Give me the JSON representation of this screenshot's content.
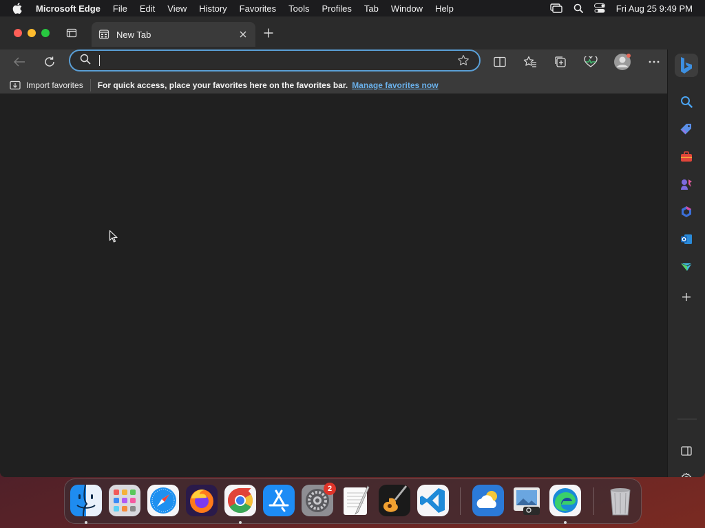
{
  "menubar": {
    "app_name": "Microsoft Edge",
    "menus": [
      "File",
      "Edit",
      "View",
      "History",
      "Favorites",
      "Tools",
      "Profiles",
      "Tab",
      "Window",
      "Help"
    ],
    "clock": "Fri Aug 25  9:49 PM"
  },
  "browser": {
    "tab": {
      "title": "New Tab"
    },
    "address": {
      "value": "",
      "placeholder": ""
    },
    "favorites_bar": {
      "import_label": "Import favorites",
      "hint": "For quick access, place your favorites here on the favorites bar.",
      "manage_link": "Manage favorites now"
    },
    "accent_color": "#5a9fd6"
  },
  "sidebar": {
    "icons": [
      "search-icon",
      "shopping-tag-icon",
      "tools-icon",
      "games-icon",
      "office-icon",
      "outlook-icon",
      "drop-icon",
      "add-icon",
      "split-screen-icon",
      "settings-icon"
    ]
  },
  "dock": {
    "apps": [
      "Finder",
      "Launchpad",
      "Safari",
      "Firefox",
      "Chrome",
      "App Store",
      "System Settings",
      "TextEdit",
      "GarageBand",
      "Visual Studio Code",
      "Weather",
      "Preview",
      "Microsoft Edge",
      "Trash"
    ],
    "settings_badge": "2"
  }
}
